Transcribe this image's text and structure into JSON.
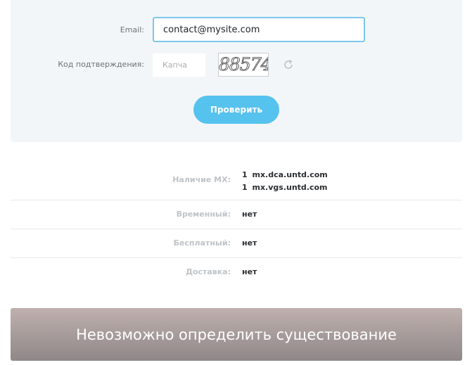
{
  "form": {
    "email_label": "Email:",
    "email_value": "contact@mysite.com",
    "code_label": "Код подтверждения:",
    "captcha_placeholder": "Капча",
    "captcha_image_text": "88574",
    "submit_label": "Проверить"
  },
  "results": {
    "mx": {
      "label": "Наличие MX:",
      "records": [
        {
          "priority": "1",
          "host": "mx.dca.untd.com"
        },
        {
          "priority": "1",
          "host": "mx.vgs.untd.com"
        }
      ]
    },
    "temporary": {
      "label": "Временный:",
      "value": "нет"
    },
    "free": {
      "label": "Бесплатный:",
      "value": "нет"
    },
    "delivery": {
      "label": "Доставка:",
      "value": "нет"
    }
  },
  "status": {
    "text": "Невозможно определить существование"
  },
  "colors": {
    "accent": "#56c2ee",
    "input_border": "#7cc7ec",
    "panel_bg": "#f3f6f8",
    "banner_top": "#bfb0ae",
    "banner_bottom": "#8f8888"
  },
  "icons": {
    "refresh": "refresh-icon"
  }
}
